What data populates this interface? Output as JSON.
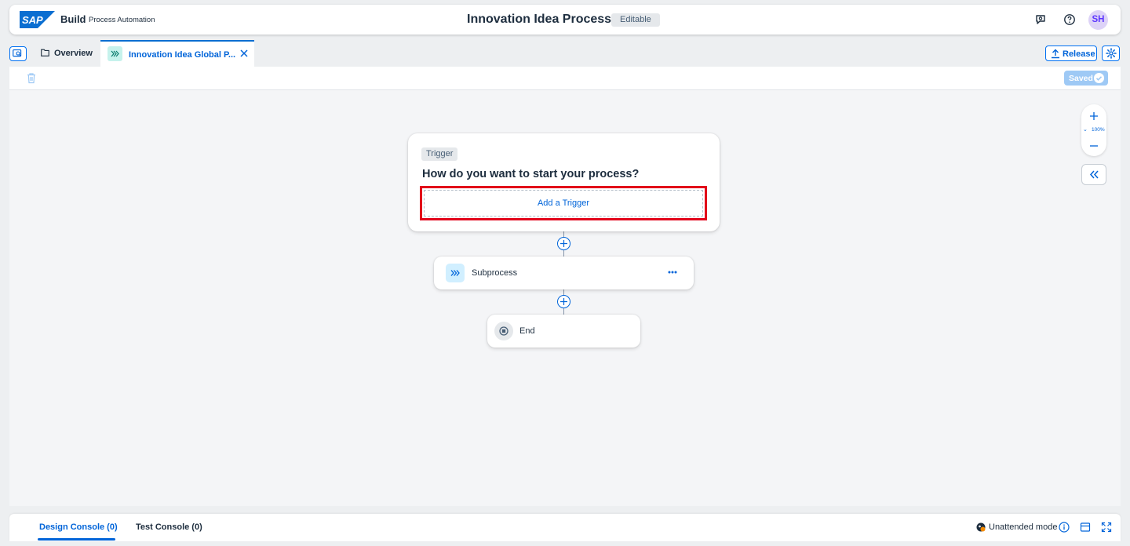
{
  "shell": {
    "logo_text": "SAP",
    "brand": "Build",
    "product": "Process Automation",
    "process_title": "Innovation Idea Process",
    "status_badge": "Editable",
    "avatar_initials": "SH"
  },
  "tabs": {
    "overview_label": "Overview",
    "active_label": "Innovation Idea Global P..."
  },
  "actions": {
    "release_label": "Release",
    "saved_label": "Saved"
  },
  "zoom": {
    "level": "100%"
  },
  "flow": {
    "trigger_tag": "Trigger",
    "trigger_question": "How do you want to start your process?",
    "add_trigger_label": "Add a Trigger",
    "subprocess_label": "Subprocess",
    "end_label": "End"
  },
  "footer": {
    "design_console": "Design Console (0)",
    "test_console": "Test Console (0)",
    "mode_label": "Unattended mode"
  },
  "colors": {
    "accent": "#0064d9",
    "highlight": "#e2001a",
    "saved_bg": "#9ec9f5",
    "canvas_bg": "#f4f5f7"
  }
}
